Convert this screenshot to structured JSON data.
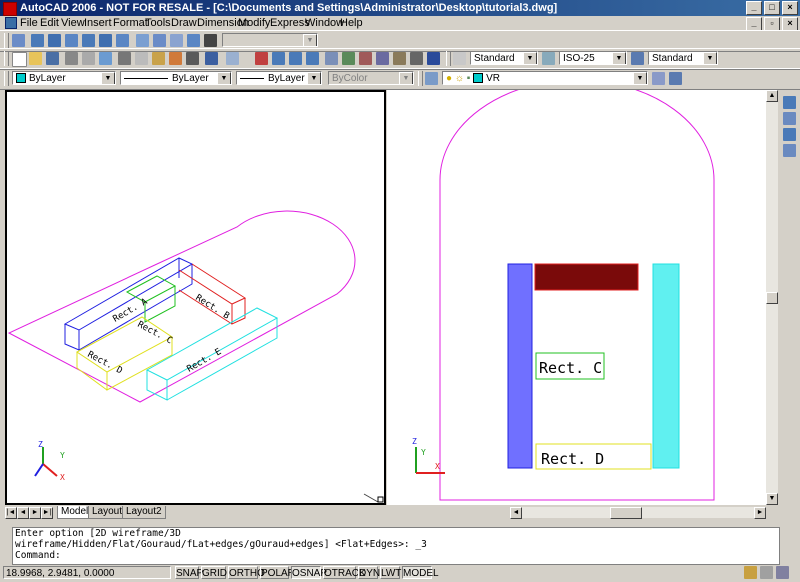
{
  "window": {
    "title": "AutoCAD 2006 - NOT FOR RESALE - [C:\\Documents and Settings\\Administrator\\Desktop\\tutorial3.dwg]",
    "min": "_",
    "max": "□",
    "close": "×",
    "mdi_min": "_",
    "mdi_restore": "▫",
    "mdi_close": "×"
  },
  "menu": [
    "File",
    "Edit",
    "View",
    "Insert",
    "Format",
    "Tools",
    "Draw",
    "Dimension",
    "Modify",
    "Express",
    "Window",
    "Help"
  ],
  "toolbar": {
    "text_style": "Standard",
    "dim_style": "ISO-25",
    "table_style": "Standard",
    "layer": "VR",
    "color": "ByLayer",
    "linetype": "ByLayer",
    "lineweight": "ByLayer",
    "plotstyle": "ByColor",
    "color_accent": "#00cccc"
  },
  "viewports": {
    "left": {
      "labels": [
        "Rect. A",
        "Rect. B",
        "Rect. C",
        "Rect. D",
        "Rect. E"
      ],
      "ucs": {
        "x": "X",
        "y": "Y",
        "z": "Z"
      }
    },
    "right": {
      "labels": [
        "Rect. C",
        "Rect. D"
      ],
      "ucs": {
        "x": "X",
        "y": "Y",
        "z": "Z"
      }
    }
  },
  "tabs": [
    "Model",
    "Layout1",
    "Layout2"
  ],
  "command": {
    "line1": "Enter option [2D wireframe/3D",
    "line2": "wireframe/Hidden/Flat/Gouraud/fLat+edges/gOuraud+edges] <Flat+Edges>: _3",
    "line3": "Command:"
  },
  "status": {
    "coords": "18.9968, 2.9481, 0.0000",
    "toggles": [
      "SNAP",
      "GRID",
      "ORTHO",
      "POLAR",
      "OSNAP",
      "OTRACK",
      "DYN",
      "LWT",
      "MODEL"
    ],
    "active": [
      "OSNAP",
      "MODEL"
    ]
  }
}
